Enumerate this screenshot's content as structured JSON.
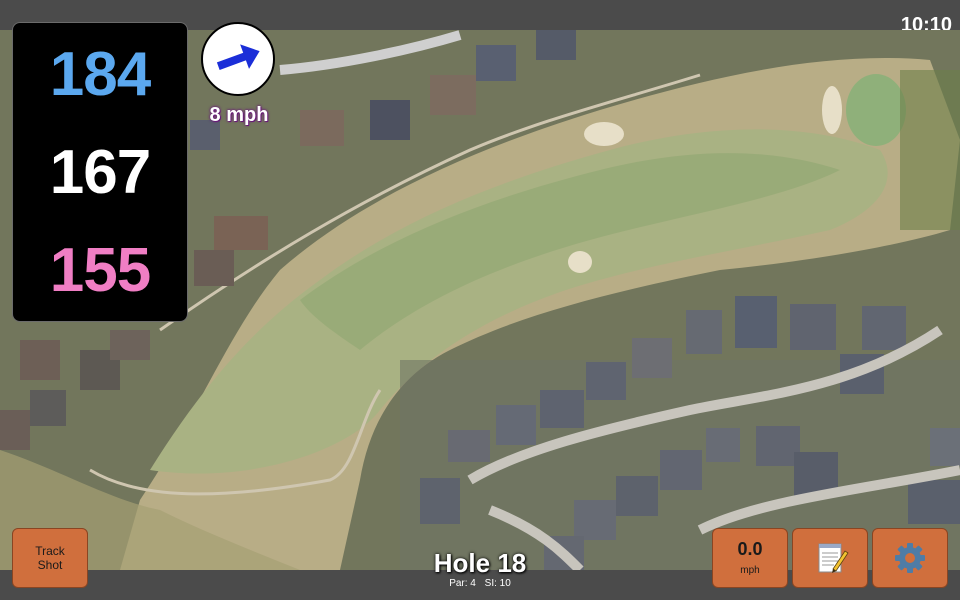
{
  "status": {
    "clock": "10:10"
  },
  "distances": {
    "back": "184",
    "middle": "167",
    "front": "155"
  },
  "wind": {
    "speed": "8 mph",
    "direction_icon": "arrow-northeast-icon"
  },
  "hole": {
    "title": "Hole 18",
    "par": "Par: 4",
    "stroke_index": "SI: 10"
  },
  "buttons": {
    "track_shot_line1": "Track",
    "track_shot_line2": "Shot",
    "speed_value": "0.0",
    "speed_unit": "mph",
    "notes_icon": "notepad-icon",
    "settings_icon": "gear-icon"
  },
  "colors": {
    "back_distance": "#5ba8ef",
    "middle_distance": "#ffffff",
    "front_distance": "#f07ec4",
    "button": "#d06f3d",
    "wind_arrow": "#1b2ed8"
  }
}
